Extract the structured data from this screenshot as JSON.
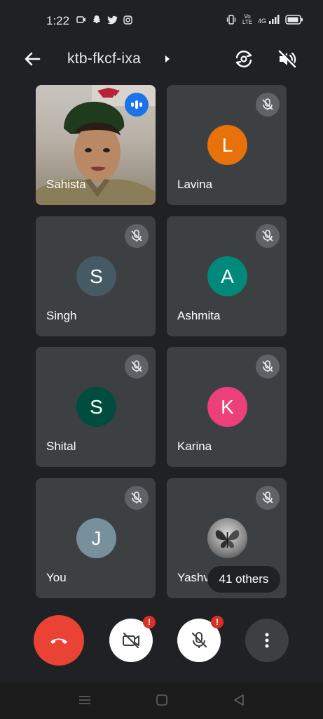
{
  "status": {
    "time": "1:22",
    "left_icons": [
      "camera-notification-icon",
      "snapchat-icon",
      "twitter-icon",
      "instagram-icon"
    ],
    "right_icons": [
      "vibrate-icon",
      "volte-icon",
      "signal-4g-icon",
      "battery-icon"
    ],
    "volte_label": "Vo LTE",
    "network_label": "4G"
  },
  "header": {
    "meeting_code": "ktb-fkcf-ixa",
    "back_icon": "arrow-back-icon",
    "caret_icon": "caret-right-icon",
    "rotate_icon": "switch-camera-icon",
    "audio_icon": "speaker-off-icon"
  },
  "participants": [
    {
      "name": "Sahista",
      "initial": "",
      "video": true,
      "speaking": true,
      "muted": false
    },
    {
      "name": "Lavina",
      "initial": "L",
      "color": "#e8710a",
      "muted": true
    },
    {
      "name": "Singh",
      "initial": "S",
      "color": "#455a64",
      "muted": true
    },
    {
      "name": "Ashmita",
      "initial": "A",
      "color": "#00897b",
      "muted": true
    },
    {
      "name": "Shital",
      "initial": "S",
      "color": "#004d40",
      "muted": true
    },
    {
      "name": "Karina",
      "initial": "K",
      "color": "#ec407a",
      "muted": true
    },
    {
      "name": "You",
      "initial": "J",
      "color": "#78909c",
      "muted": true
    },
    {
      "name": "Yashvi",
      "initial": "",
      "photo": true,
      "muted": true
    }
  ],
  "others_label": "41 others",
  "controls": {
    "end_call_icon": "phone-hangup-icon",
    "camera_icon": "camera-off-icon",
    "camera_alert": "!",
    "mic_icon": "mic-off-icon",
    "mic_alert": "!",
    "more_icon": "more-vert-icon"
  },
  "colors": {
    "background": "#202124",
    "tile": "#3c4043",
    "end_call": "#ea4335",
    "alert": "#d93025",
    "speaking": "#1a73e8"
  },
  "navbar": [
    "menu-icon",
    "home-icon",
    "back-triangle-icon"
  ]
}
